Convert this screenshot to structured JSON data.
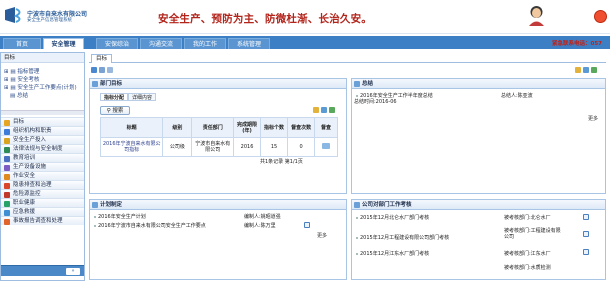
{
  "header": {
    "org_name": "宁波市自来水有限公司",
    "system_name": "安全生产信息管理系统",
    "slogan": "安全生产、预防为主、防微杜渐、长治久安。",
    "hotline": "紧急联系电话：057"
  },
  "nav": {
    "tabs": [
      "首页",
      "安全管理",
      "安保综治",
      "沟通交流",
      "我的工作",
      "系统管理"
    ],
    "active": "安全管理"
  },
  "sidebar": {
    "tree_root": "目标",
    "tree_items": [
      "指标管理",
      "安全考核",
      "安全生产工作要点(计划)",
      "总结"
    ],
    "menu": [
      {
        "label": "目标",
        "icon": "target-icon",
        "color": "#e5a623"
      },
      {
        "label": "组织机构和职责",
        "icon": "org-icon",
        "color": "#3b7dd8"
      },
      {
        "label": "安全生产投入",
        "icon": "money-icon",
        "color": "#d9a520"
      },
      {
        "label": "法律法规与安全制度",
        "icon": "book-icon",
        "color": "#2e8b57"
      },
      {
        "label": "教育培训",
        "icon": "education-icon",
        "color": "#4a6fc0"
      },
      {
        "label": "生产设备设施",
        "icon": "equipment-icon",
        "color": "#7c5cc4"
      },
      {
        "label": "作业安全",
        "icon": "work-icon",
        "color": "#e08a1e"
      },
      {
        "label": "隐患排查和治理",
        "icon": "hazard-icon",
        "color": "#d9462a"
      },
      {
        "label": "危险源监控",
        "icon": "danger-icon",
        "color": "#c0392b"
      },
      {
        "label": "职业健康",
        "icon": "health-icon",
        "color": "#27a36a"
      },
      {
        "label": "应急救援",
        "icon": "rescue-icon",
        "color": "#3f8fd4"
      },
      {
        "label": "事故报告调查和处理",
        "icon": "report-icon",
        "color": "#e0662e"
      }
    ],
    "collapse_label": "»"
  },
  "main": {
    "breadcrumb": "目标",
    "panel_target": {
      "title": "部门目标",
      "sub_tabs": [
        "指标分配",
        "详细内容"
      ],
      "search_label": "搜索",
      "columns": [
        "标题",
        "级别",
        "责任部门",
        "完成期限(年)",
        "指标个数",
        "督查次数",
        "督查"
      ],
      "rows": [
        {
          "title": "2016年宁波自来水有限公司指标",
          "level": "公司级",
          "dept": "宁波市自来水有限公司",
          "year": "2016",
          "count": "15",
          "checks": "0"
        }
      ],
      "pager": "共1条记录 第1/1页"
    },
    "panel_summary": {
      "title": "总结",
      "item_title": "2016年安全生产工作半年度总结",
      "item_date": "总结时间:2016-06",
      "item_author": "总结人:陈亚波",
      "more": "更多"
    },
    "panel_plan": {
      "title": "计划制定",
      "items": [
        {
          "title": "2016年安全生产计划",
          "author": "编制人:姚昭道强"
        },
        {
          "title": "2016年宁波市自来水有限公司安全生产工作要点",
          "author": "编制人:陈万里"
        }
      ],
      "more": "更多"
    },
    "panel_assess": {
      "title": "公司对部门工作考核",
      "items": [
        {
          "title": "2015年12月北仑水厂部门考核",
          "dept": "被考核部门:北仑水厂"
        },
        {
          "title": "2015年12月工程建设有限公司部门考核",
          "dept": "被考核部门:工程建设有限公司"
        },
        {
          "title": "2015年12月江东水厂部门考核",
          "dept": "被考核部门:江东水厂"
        },
        {
          "title": "",
          "dept": "被考核部门:水质检测"
        }
      ]
    }
  },
  "colors": {
    "nav_bg": "#3c7fc4",
    "accent_red": "#b3241b",
    "link": "#2c3f8f"
  }
}
